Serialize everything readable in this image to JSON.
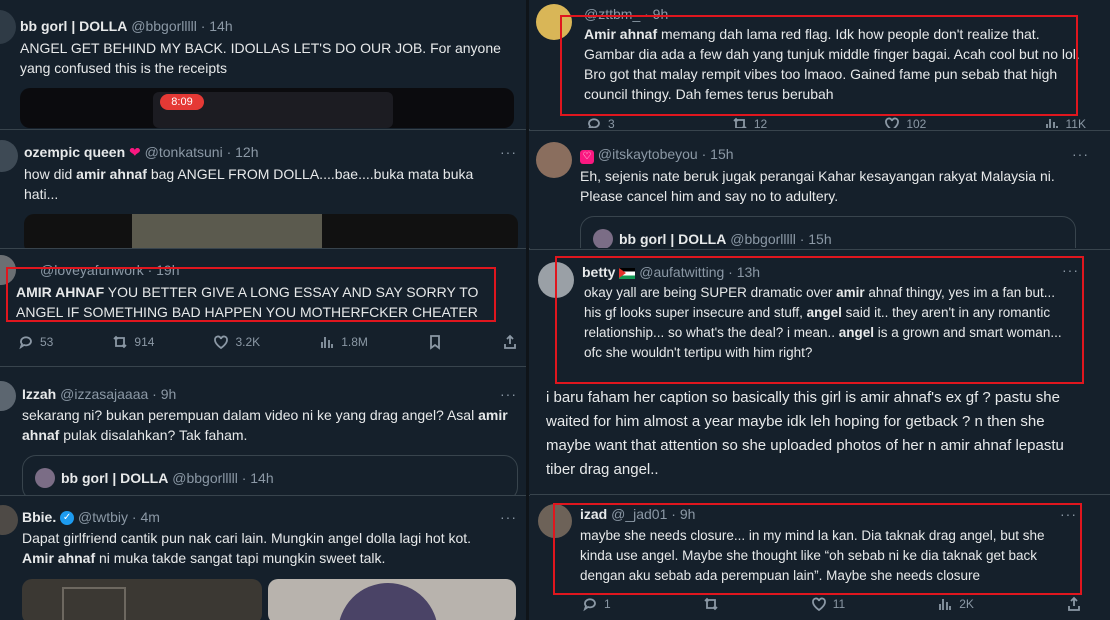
{
  "t1": {
    "name": "bb gorl | DOLLA",
    "handle": "@bbgorlllll",
    "time": "· 14h",
    "text": "ANGEL GET BEHIND MY BACK. IDOLLAS LET'S DO OUR JOB. For anyone yang confused this is the receipts",
    "media_time": "8:09"
  },
  "t2": {
    "name": "ozempic queen",
    "handle": "@tonkatsuni",
    "time": "· 12h",
    "prefix": "how did ",
    "bold1": "amir ahnaf",
    "text": " bag ANGEL FROM DOLLA....bae....buka mata buka hati..."
  },
  "t3": {
    "handle": "@loveyafunwork",
    "time": "· 19h",
    "bold1": "AMIR AHNAF",
    "text": " YOU BETTER GIVE A LONG ESSAY AND SAY SORRY TO ANGEL IF SOMETHING BAD HAPPEN YOU MOTHERFCKER CHEATER",
    "replies": "53",
    "reposts": "914",
    "likes": "3.2K",
    "views": "1.8M"
  },
  "t4": {
    "name": "Izzah",
    "handle": "@izzasajaaaa",
    "time": "· 9h",
    "text1": "sekarang ni? bukan perempuan dalam video ni ke yang drag angel? Asal ",
    "bold1": "amir ahnaf",
    "text2": " pulak disalahkan? Tak faham.",
    "quote_name": "bb gorl | DOLLA",
    "quote_handle": "@bbgorlllll",
    "quote_time": "· 14h"
  },
  "t5": {
    "name": "Bbie.",
    "handle": "@twtbiy",
    "time": "· 4m",
    "text1": "Dapat girlfriend cantik pun nak cari lain. Mungkin angel dolla lagi hot kot.",
    "bold1": "Amir ahnaf",
    "text2": " ni muka takde sangat tapi mungkin sweet talk."
  },
  "t6": {
    "handle": "@zttbm_",
    "time": "· 9h",
    "bold1": "Amir ahnaf",
    "text": " memang dah lama red flag. Idk how people don't realize that. Gambar dia ada a few dah yang tunjuk middle finger bagai. Acah cool but no lol. Bro got that malay rempit vibes too lmaoo. Gained fame pun sebab that high council thingy. Dah femes terus berubah",
    "replies": "3",
    "reposts": "12",
    "likes": "102",
    "views": "11K"
  },
  "t7": {
    "handle": "@itskaytobeyou",
    "time": "· 15h",
    "text": "Eh, sejenis nate beruk jugak perangai Kahar kesayangan rakyat Malaysia ni. Please cancel him and say no to adultery.",
    "quote_name": "bb gorl | DOLLA",
    "quote_handle": "@bbgorlllll",
    "quote_time": "· 15h"
  },
  "t8": {
    "name": "betty",
    "handle": "@aufatwitting",
    "time": "· 13h",
    "text1": "okay yall are being SUPER dramatic over ",
    "bold1": "amir",
    "text2": " ahnaf thingy, yes im a fan but... his gf looks super insecure and stuff, ",
    "bold2": "angel",
    "text3": " said it.. they aren't in any romantic relationship... so what's the deal? i mean.. ",
    "bold3": "angel",
    "text4": " is a grown and smart woman... ofc she wouldn't tertipu with him right?"
  },
  "t9": {
    "text": "i baru faham her caption so basically this girl is amir ahnaf's ex gf ? pastu she waited for him almost a year maybe idk leh hoping for getback ? n then she maybe want that attention so she uploaded photos of her n amir ahnaf lepastu tiber drag angel.."
  },
  "t10": {
    "name": "izad",
    "handle": "@_jad01",
    "time": "· 9h",
    "text": "maybe she needs closure... in my mind la kan. Dia taknak drag angel, but she kinda use angel. Maybe she thought like “oh sebab ni ke dia taknak get back dengan aku sebab ada perempuan lain”. Maybe she needs closure",
    "replies": "1",
    "likes": "11",
    "views": "2K"
  },
  "more": "···",
  "colors": {
    "bg": "#15202b",
    "text": "#e7e9ea",
    "muted": "#8b98a5",
    "highlight": "#e0161e",
    "divider": "#38444d"
  }
}
